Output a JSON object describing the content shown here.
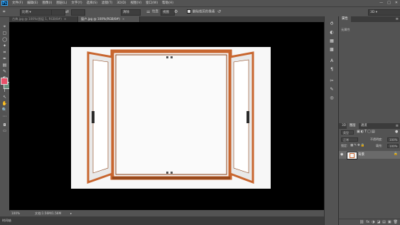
{
  "app": {
    "logo": "Ps"
  },
  "menu": [
    "文件(F)",
    "编辑(E)",
    "图像(I)",
    "图层(L)",
    "文字(Y)",
    "选择(S)",
    "滤镜(T)",
    "3D(D)",
    "视图(V)",
    "窗口(W)",
    "帮助(H)"
  ],
  "window_controls": {
    "minimize": "—",
    "maximize": "□",
    "close": "✕"
  },
  "options": {
    "ratio_select": "比例",
    "ratio_w": "",
    "ratio_h": "",
    "clear_label": "清除",
    "straighten_label": "拉直",
    "view_select": "视图",
    "delete_cropped_label": "删除裁剪的像素",
    "workspace_value": "3D"
  },
  "tabs": [
    {
      "label": "古典.jpg @ 100%(图层 1, RGB/8#)",
      "close": "×",
      "active": false
    },
    {
      "label": "窗户.jpg @ 100%(RGB/8#)",
      "close": "×",
      "active": true
    }
  ],
  "tools": [
    "⌖",
    "▢",
    "◯",
    "✦",
    "⌗",
    "✒",
    "▤",
    "✎",
    "◐",
    "✿",
    "T",
    "↖",
    "✋",
    "🔍",
    "⋯"
  ],
  "colors": {
    "foreground": "#e8516a",
    "background": "#6c8f7f",
    "accent": "#31a8ff",
    "wood": "#c8662f"
  },
  "status": {
    "zoom": "100%",
    "doc_info": "文档:1.56M/1.56M",
    "arrow": "▸"
  },
  "right_panel": {
    "top_tab": "属性",
    "top_subtitle": "无属性",
    "layers_tabs": [
      "3D",
      "图层",
      "通道"
    ],
    "kind_label": "类型",
    "blend_mode": "正常",
    "opacity_label": "不透明度:",
    "opacity_value": "100%",
    "lock_label": "锁定:",
    "fill_label": "填充:",
    "fill_value": "100%",
    "layer_name": "背景",
    "layer_lock_icon": "🔒",
    "footer_icons": [
      "⛓",
      "fx",
      "◑",
      "◪",
      "▤",
      "▣",
      "🗑"
    ]
  },
  "bottom_tab": "时间轴"
}
